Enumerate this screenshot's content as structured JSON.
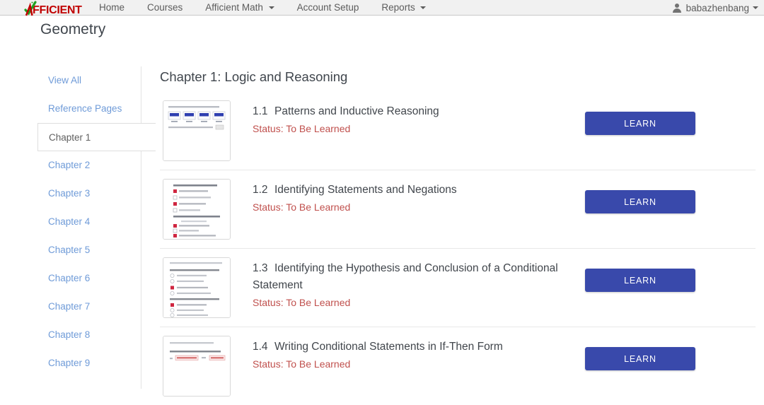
{
  "navbar": {
    "brand": {
      "text": "FFICIENT",
      "full_name": "AFFICIENT",
      "check_color": "#21a121",
      "text_color": "#c00000"
    },
    "links": [
      {
        "label": "Home",
        "dropdown": false
      },
      {
        "label": "Courses",
        "dropdown": false
      },
      {
        "label": "Afficient Math",
        "dropdown": true
      },
      {
        "label": "Account Setup",
        "dropdown": false
      },
      {
        "label": "Reports",
        "dropdown": true
      }
    ],
    "user": {
      "name": "babazhenbang",
      "dropdown": true
    }
  },
  "page": {
    "title": "Geometry"
  },
  "sidebar": {
    "items": [
      {
        "label": "View All",
        "active": false
      },
      {
        "label": "Reference Pages",
        "active": false
      },
      {
        "label": "Chapter 1",
        "active": true
      },
      {
        "label": "Chapter 2",
        "active": false
      },
      {
        "label": "Chapter 3",
        "active": false
      },
      {
        "label": "Chapter 4",
        "active": false
      },
      {
        "label": "Chapter 5",
        "active": false
      },
      {
        "label": "Chapter 6",
        "active": false
      },
      {
        "label": "Chapter 7",
        "active": false
      },
      {
        "label": "Chapter 8",
        "active": false
      },
      {
        "label": "Chapter 9",
        "active": false
      }
    ]
  },
  "main": {
    "chapter_heading": "Chapter 1: Logic and Reasoning",
    "button_label": "LEARN",
    "button_color": "#3949ab",
    "status_color": "#c0504d",
    "lessons": [
      {
        "number": "1.1",
        "title": "Patterns and Inductive Reasoning",
        "status": "Status: To Be Learned",
        "thumbnail": "step-figures-worksheet-thumbnail",
        "action": "LEARN"
      },
      {
        "number": "1.2",
        "title": "Identifying Statements and Negations",
        "status": "Status: To Be Learned",
        "thumbnail": "multiple-choice-quiz-thumbnail",
        "action": "LEARN"
      },
      {
        "number": "1.3",
        "title": "Identifying the Hypothesis and Conclusion of a Conditional Statement",
        "status": "Status: To Be Learned",
        "thumbnail": "radio-choice-quiz-thumbnail",
        "action": "LEARN"
      },
      {
        "number": "1.4",
        "title": "Writing Conditional Statements in If-Then Form",
        "status": "Status: To Be Learned",
        "thumbnail": "fill-in-blanks-thumbnail",
        "action": "LEARN"
      }
    ]
  }
}
